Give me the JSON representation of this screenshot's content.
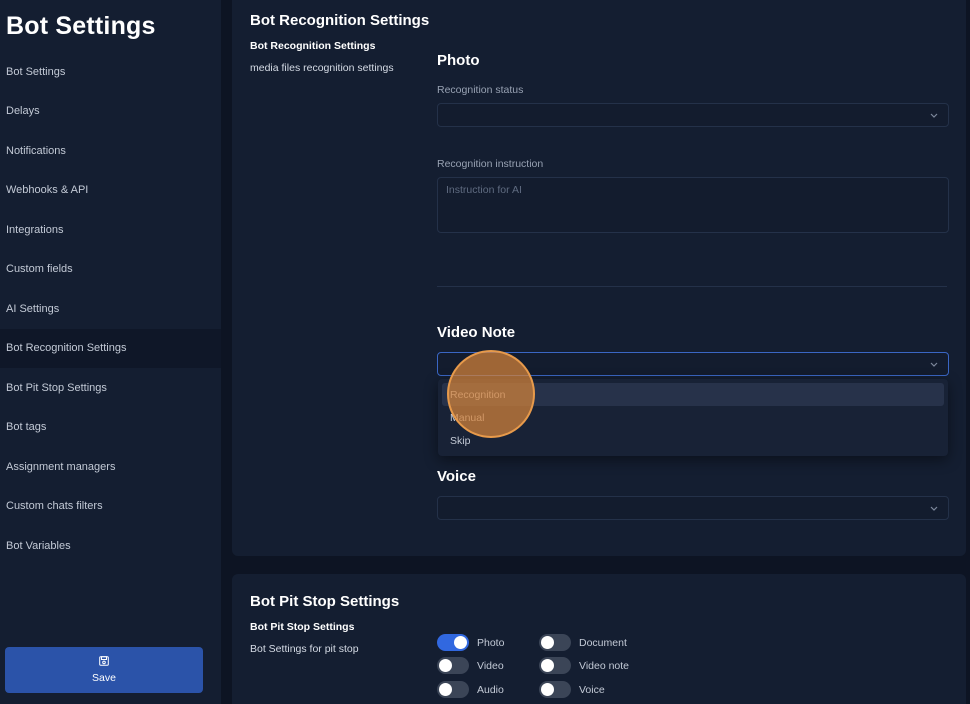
{
  "sidebar": {
    "title": "Bot Settings",
    "items": [
      {
        "label": "Bot Settings"
      },
      {
        "label": "Delays"
      },
      {
        "label": "Notifications"
      },
      {
        "label": "Webhooks & API"
      },
      {
        "label": "Integrations"
      },
      {
        "label": "Custom fields"
      },
      {
        "label": "AI Settings"
      },
      {
        "label": "Bot Recognition Settings",
        "active": true
      },
      {
        "label": "Bot Pit Stop Settings"
      },
      {
        "label": "Bot tags"
      },
      {
        "label": "Assignment managers"
      },
      {
        "label": "Custom chats filters"
      },
      {
        "label": "Bot Variables"
      }
    ],
    "save_label": "Save",
    "save_icon": "floppy-disk-icon"
  },
  "recognition": {
    "title": "Bot Recognition Settings",
    "subtitle": "Bot Recognition Settings",
    "description": "media files recognition settings",
    "photo": {
      "heading": "Photo",
      "status_label": "Recognition status",
      "status_value": "",
      "instruction_label": "Recognition instruction",
      "instruction_placeholder": "Instruction for AI"
    },
    "video_note": {
      "heading": "Video Note",
      "value": "",
      "options": [
        "Recognition",
        "Manual",
        "Skip"
      ],
      "highlighted": "Recognition"
    },
    "voice": {
      "heading": "Voice",
      "value": ""
    }
  },
  "pitstop": {
    "title": "Bot Pit Stop Settings",
    "subtitle": "Bot Pit Stop Settings",
    "description": "Bot Settings for pit stop",
    "toggles": [
      {
        "label": "Photo",
        "on": true
      },
      {
        "label": "Document",
        "on": false
      },
      {
        "label": "Video",
        "on": false
      },
      {
        "label": "Video note",
        "on": false
      },
      {
        "label": "Audio",
        "on": false
      },
      {
        "label": "Voice",
        "on": false
      }
    ]
  },
  "colors": {
    "background": "#0d1423",
    "panel": "#141e31",
    "accent": "#3168e0",
    "save_button": "#2b53a9",
    "touch_indicator": "#e79a4b"
  }
}
